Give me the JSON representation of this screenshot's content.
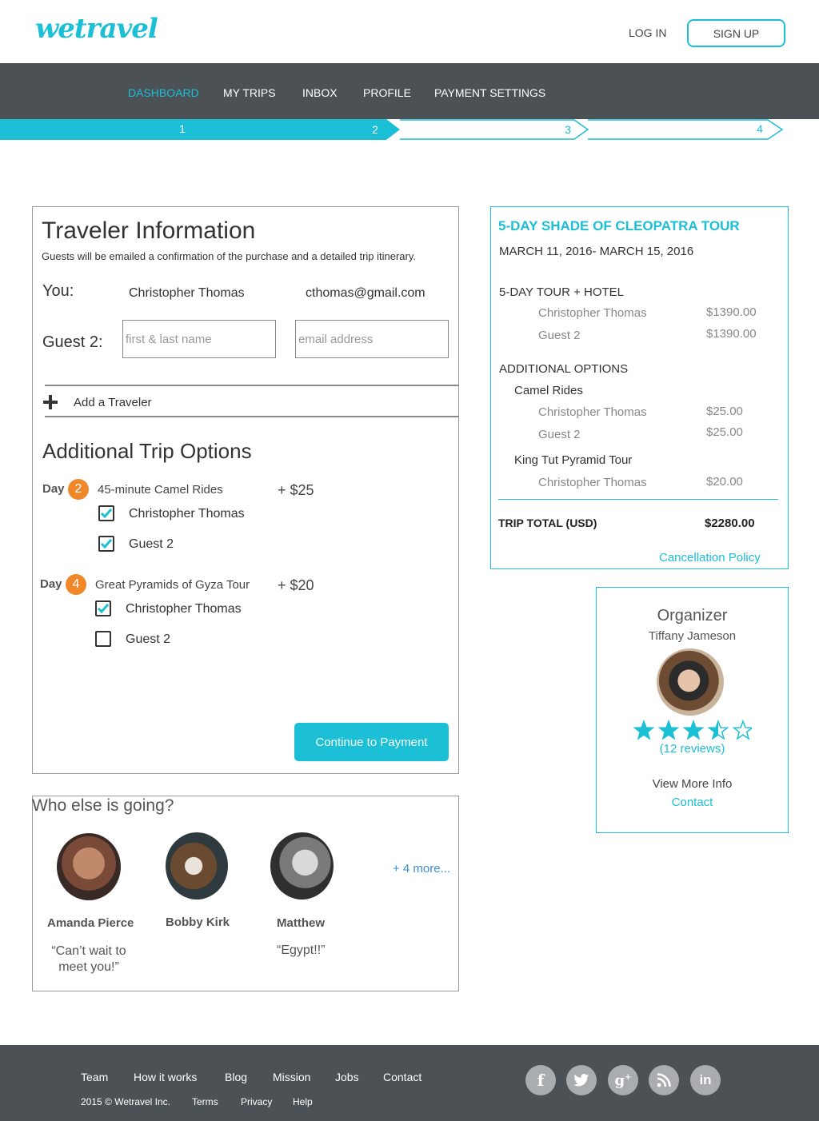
{
  "header": {
    "logo": "wetravel",
    "login_label": "LOG IN",
    "signup_label": "SIGN UP"
  },
  "nav": {
    "items": [
      "DASHBOARD",
      "MY TRIPS",
      "INBOX",
      "PROFILE",
      "PAYMENT SETTINGS"
    ],
    "active": "DASHBOARD"
  },
  "progress": {
    "steps": [
      "1",
      "2",
      "3",
      "4"
    ],
    "current_step": 2
  },
  "traveler": {
    "title": "Traveler Information",
    "subtitle": "Guests will be emailed a confirmation of the purchase and a detailed trip itinerary.",
    "you_label": "You:",
    "you_name": "Christopher Thomas",
    "you_email": "cthomas@gmail.com",
    "guest_label": "Guest 2:",
    "name_placeholder": "first & last name",
    "email_placeholder": "email address",
    "add_traveler": "Add a Traveler"
  },
  "options": {
    "title": "Additional Trip Options",
    "day_label": "Day",
    "items": [
      {
        "day": "2",
        "name": "45-minute Camel Rides",
        "price": "+ $25",
        "travelers": [
          {
            "name": "Christopher Thomas",
            "checked": true
          },
          {
            "name": "Guest 2",
            "checked": true
          }
        ]
      },
      {
        "day": "4",
        "name": "Great Pyramids of Gyza Tour",
        "price": "+ $20",
        "travelers": [
          {
            "name": "Christopher Thomas",
            "checked": true
          },
          {
            "name": "Guest 2",
            "checked": false
          }
        ]
      }
    ],
    "continue_label": "Continue to Payment"
  },
  "going": {
    "title": "Who else is going?",
    "people": [
      {
        "name": "Amanda Pierce",
        "quote": "“Can’t wait to meet you!”"
      },
      {
        "name": "Bobby Kirk",
        "quote": ""
      },
      {
        "name": "Matthew",
        "quote": "“Egypt!!”"
      }
    ],
    "more": "+ 4 more..."
  },
  "summary": {
    "tour_title": "5-DAY SHADE OF CLEOPATRA TOUR",
    "dates": "MARCH 11, 2016- MARCH 15, 2016",
    "package_label": "5-DAY TOUR + HOTEL",
    "package_lines": [
      {
        "name": "Christopher Thomas",
        "amount": "$1390.00"
      },
      {
        "name": "Guest 2",
        "amount": "$1390.00"
      }
    ],
    "additional_label": "ADDITIONAL OPTIONS",
    "camel_label": "Camel Rides",
    "camel_lines": [
      {
        "name": "Christopher Thomas",
        "amount": "$25.00"
      },
      {
        "name": "Guest 2",
        "amount": "$25.00"
      }
    ],
    "kingtut_label": "King Tut Pyramid Tour",
    "kingtut_lines": [
      {
        "name": "Christopher Thomas",
        "amount": "$20.00"
      }
    ],
    "total_label": "TRIP TOTAL (USD)",
    "total_amount": "$2280.00",
    "cancellation": "Cancellation Policy"
  },
  "organizer": {
    "title": "Organizer",
    "name": "Tiffany Jameson",
    "rating": 3.5,
    "rating_max": 5,
    "reviews": "(12 reviews)",
    "view_more": "View More Info",
    "contact": "Contact"
  },
  "footer": {
    "links": [
      "Team",
      "How it works",
      "Blog",
      "Mission",
      "Jobs",
      "Contact"
    ],
    "copyright": "2015 © Wetravel Inc.",
    "sub_links": [
      "Terms",
      "Privacy",
      "Help"
    ],
    "social": [
      "facebook-icon",
      "twitter-icon",
      "google-plus-icon",
      "rss-icon",
      "linkedin-icon"
    ]
  },
  "colors": {
    "accent": "#1bbfd6",
    "nav_bg": "#4b5155",
    "day_badge": "#f0882a"
  }
}
